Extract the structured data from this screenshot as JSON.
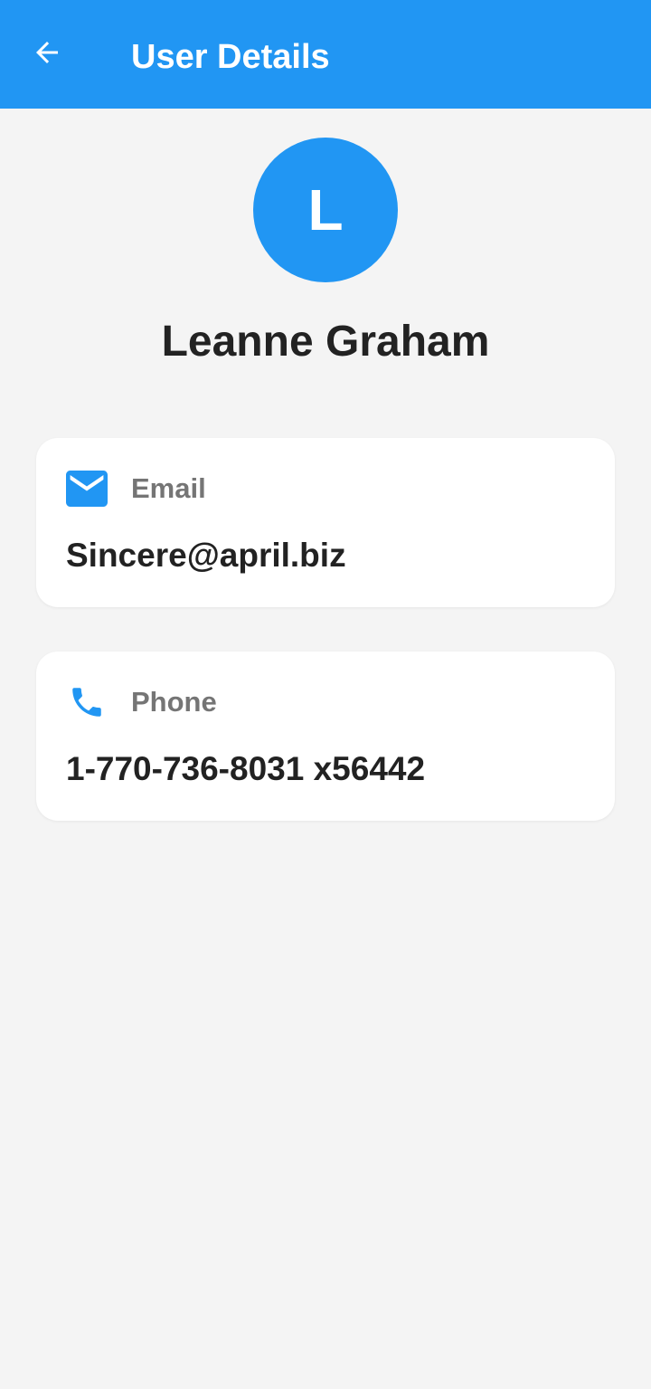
{
  "app_bar": {
    "title": "User Details",
    "back_icon": "arrow-back-icon",
    "color": "#2196f3"
  },
  "profile": {
    "avatar_letter": "L",
    "name": "Leanne Graham",
    "avatar_color": "#2196f3"
  },
  "cards": {
    "email": {
      "icon": "email-icon",
      "label": "Email",
      "value": "Sincere@april.biz"
    },
    "phone": {
      "icon": "phone-icon",
      "label": "Phone",
      "value": "1-770-736-8031 x56442"
    }
  }
}
